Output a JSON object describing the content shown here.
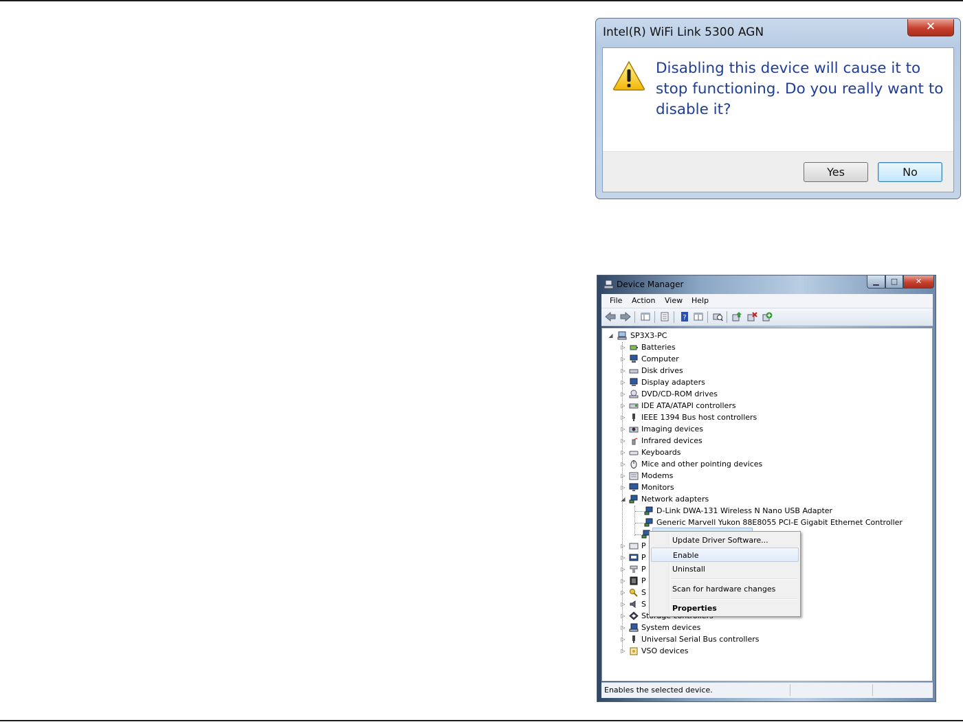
{
  "dialog": {
    "title": "Intel(R) WiFi Link 5300 AGN",
    "close_glyph": "✕",
    "icon": "warning-icon",
    "message": "Disabling this device will cause it to stop functioning. Do you really want to disable it?",
    "yes_label": "Yes",
    "no_label": "No"
  },
  "device_manager": {
    "title": "Device Manager",
    "window_buttons": {
      "minimize": "▁",
      "maximize": "□",
      "close": "✕"
    },
    "menu": [
      "File",
      "Action",
      "View",
      "Help"
    ],
    "toolbar_icons": [
      "back-arrow-icon",
      "forward-arrow-icon",
      "show-hide-console-tree-icon",
      "properties-icon",
      "help-icon",
      "view-icon",
      "scan-hardware-icon",
      "update-driver-icon",
      "uninstall-icon",
      "enable-device-icon"
    ],
    "tree": {
      "root": "SP3X3-PC",
      "categories": [
        "Batteries",
        "Computer",
        "Disk drives",
        "Display adapters",
        "DVD/CD-ROM drives",
        "IDE ATA/ATAPI controllers",
        "IEEE 1394 Bus host controllers",
        "Imaging devices",
        "Infrared devices",
        "Keyboards",
        "Mice and other pointing devices",
        "Modems",
        "Monitors",
        "Network adapters"
      ],
      "network_children": [
        "D-Link DWA-131 Wireless N Nano USB Adapter",
        "Generic Marvell Yukon 88E8055 PCI-E Gigabit Ethernet Controller"
      ],
      "hidden_categories_initials": [
        "P",
        "P",
        "P",
        "P",
        "S",
        "S"
      ],
      "partial_category": "Storage controllers",
      "after_categories": [
        "System devices",
        "Universal Serial Bus controllers",
        "VSO devices"
      ]
    },
    "context_menu": {
      "items": [
        "Update Driver Software...",
        "Enable",
        "Uninstall",
        "Scan for hardware changes",
        "Properties"
      ],
      "highlighted": "Enable"
    },
    "status_text": "Enables the selected device."
  }
}
